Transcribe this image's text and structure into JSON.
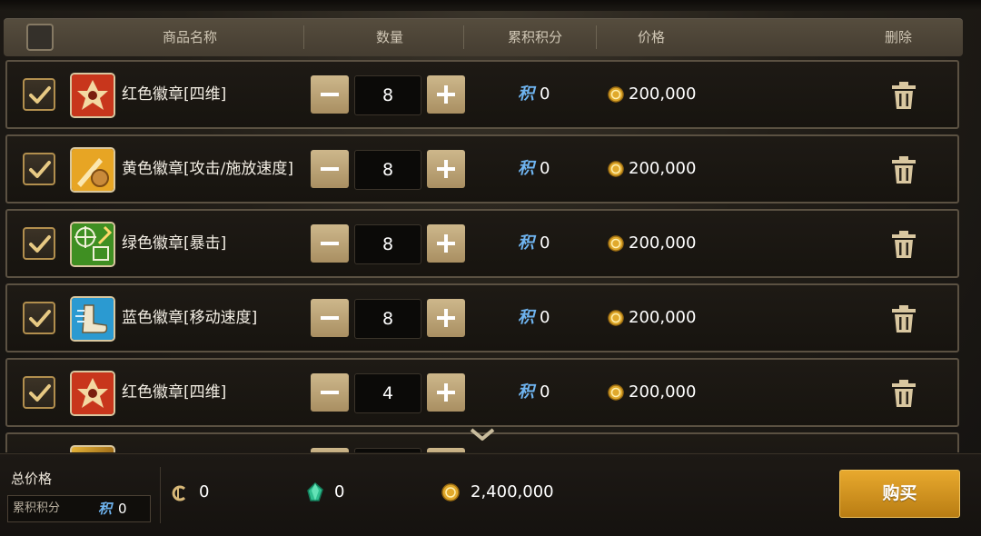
{
  "header": {
    "col_name": "商品名称",
    "col_qty": "数量",
    "col_points": "累积积分",
    "col_price": "价格",
    "col_delete": "删除"
  },
  "points_glyph": "积",
  "rows": [
    {
      "name": "红色徽章[四维]",
      "qty": "8",
      "points": "0",
      "price": "200,000",
      "icon": "red-badge-stats-icon",
      "checked": true
    },
    {
      "name": "黄色徽章[攻击/施放速度]",
      "qty": "8",
      "points": "0",
      "price": "200,000",
      "icon": "yellow-badge-speed-icon",
      "checked": true
    },
    {
      "name": "绿色徽章[暴击]",
      "qty": "8",
      "points": "0",
      "price": "200,000",
      "icon": "green-badge-crit-icon",
      "checked": true
    },
    {
      "name": "蓝色徽章[移动速度]",
      "qty": "8",
      "points": "0",
      "price": "200,000",
      "icon": "blue-badge-move-speed-icon",
      "checked": true
    },
    {
      "name": "红色徽章[四维]",
      "qty": "4",
      "points": "0",
      "price": "200,000",
      "icon": "red-badge-stats-icon",
      "checked": true
    }
  ],
  "footer": {
    "total_label": "总价格",
    "points_label": "累积积分",
    "points_value": "0",
    "cera_value": "0",
    "gem_value": "0",
    "gold_value": "2,400,000",
    "buy_label": "购买"
  },
  "colors": {
    "accent_gold": "#c9922a",
    "points_blue": "#6fb4f0",
    "button_tan": "#bfa676"
  }
}
